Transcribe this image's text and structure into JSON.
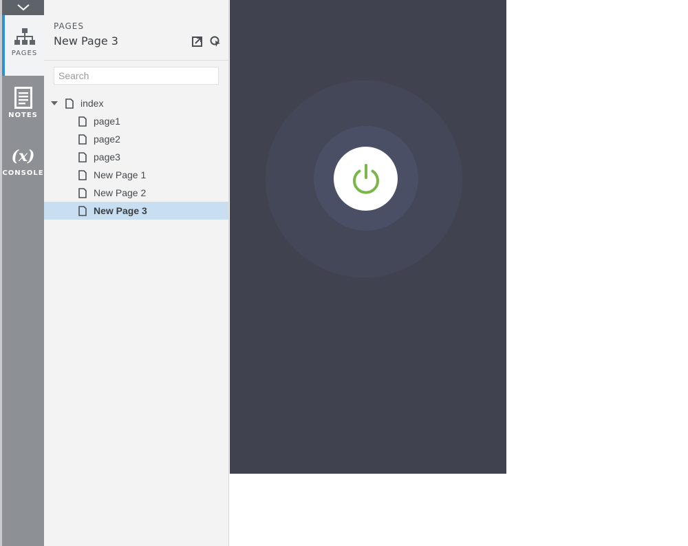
{
  "rail": {
    "items": [
      {
        "label": "PAGES",
        "icon": "sitemap-icon",
        "active": true
      },
      {
        "label": "NOTES",
        "icon": "notes-icon",
        "active": false
      },
      {
        "label": "CONSOLE",
        "icon": "variable-icon",
        "glyph": "(x)",
        "active": false
      }
    ]
  },
  "panel": {
    "kicker": "PAGES",
    "title": "New Page 3",
    "search_placeholder": "Search"
  },
  "tree": [
    {
      "label": "index",
      "level": 0,
      "expanded": true
    },
    {
      "label": "page1",
      "level": 1
    },
    {
      "label": "page2",
      "level": 1
    },
    {
      "label": "page3",
      "level": 1
    },
    {
      "label": "New Page 1",
      "level": 1
    },
    {
      "label": "New Page 2",
      "level": 1
    },
    {
      "label": "New Page 3",
      "level": 1,
      "selected": true
    }
  ],
  "colors": {
    "accent": "#2d8fd6",
    "selected_row": "#c8dff1",
    "canvas_bg": "#40434f",
    "power_green": "#7ab648"
  }
}
